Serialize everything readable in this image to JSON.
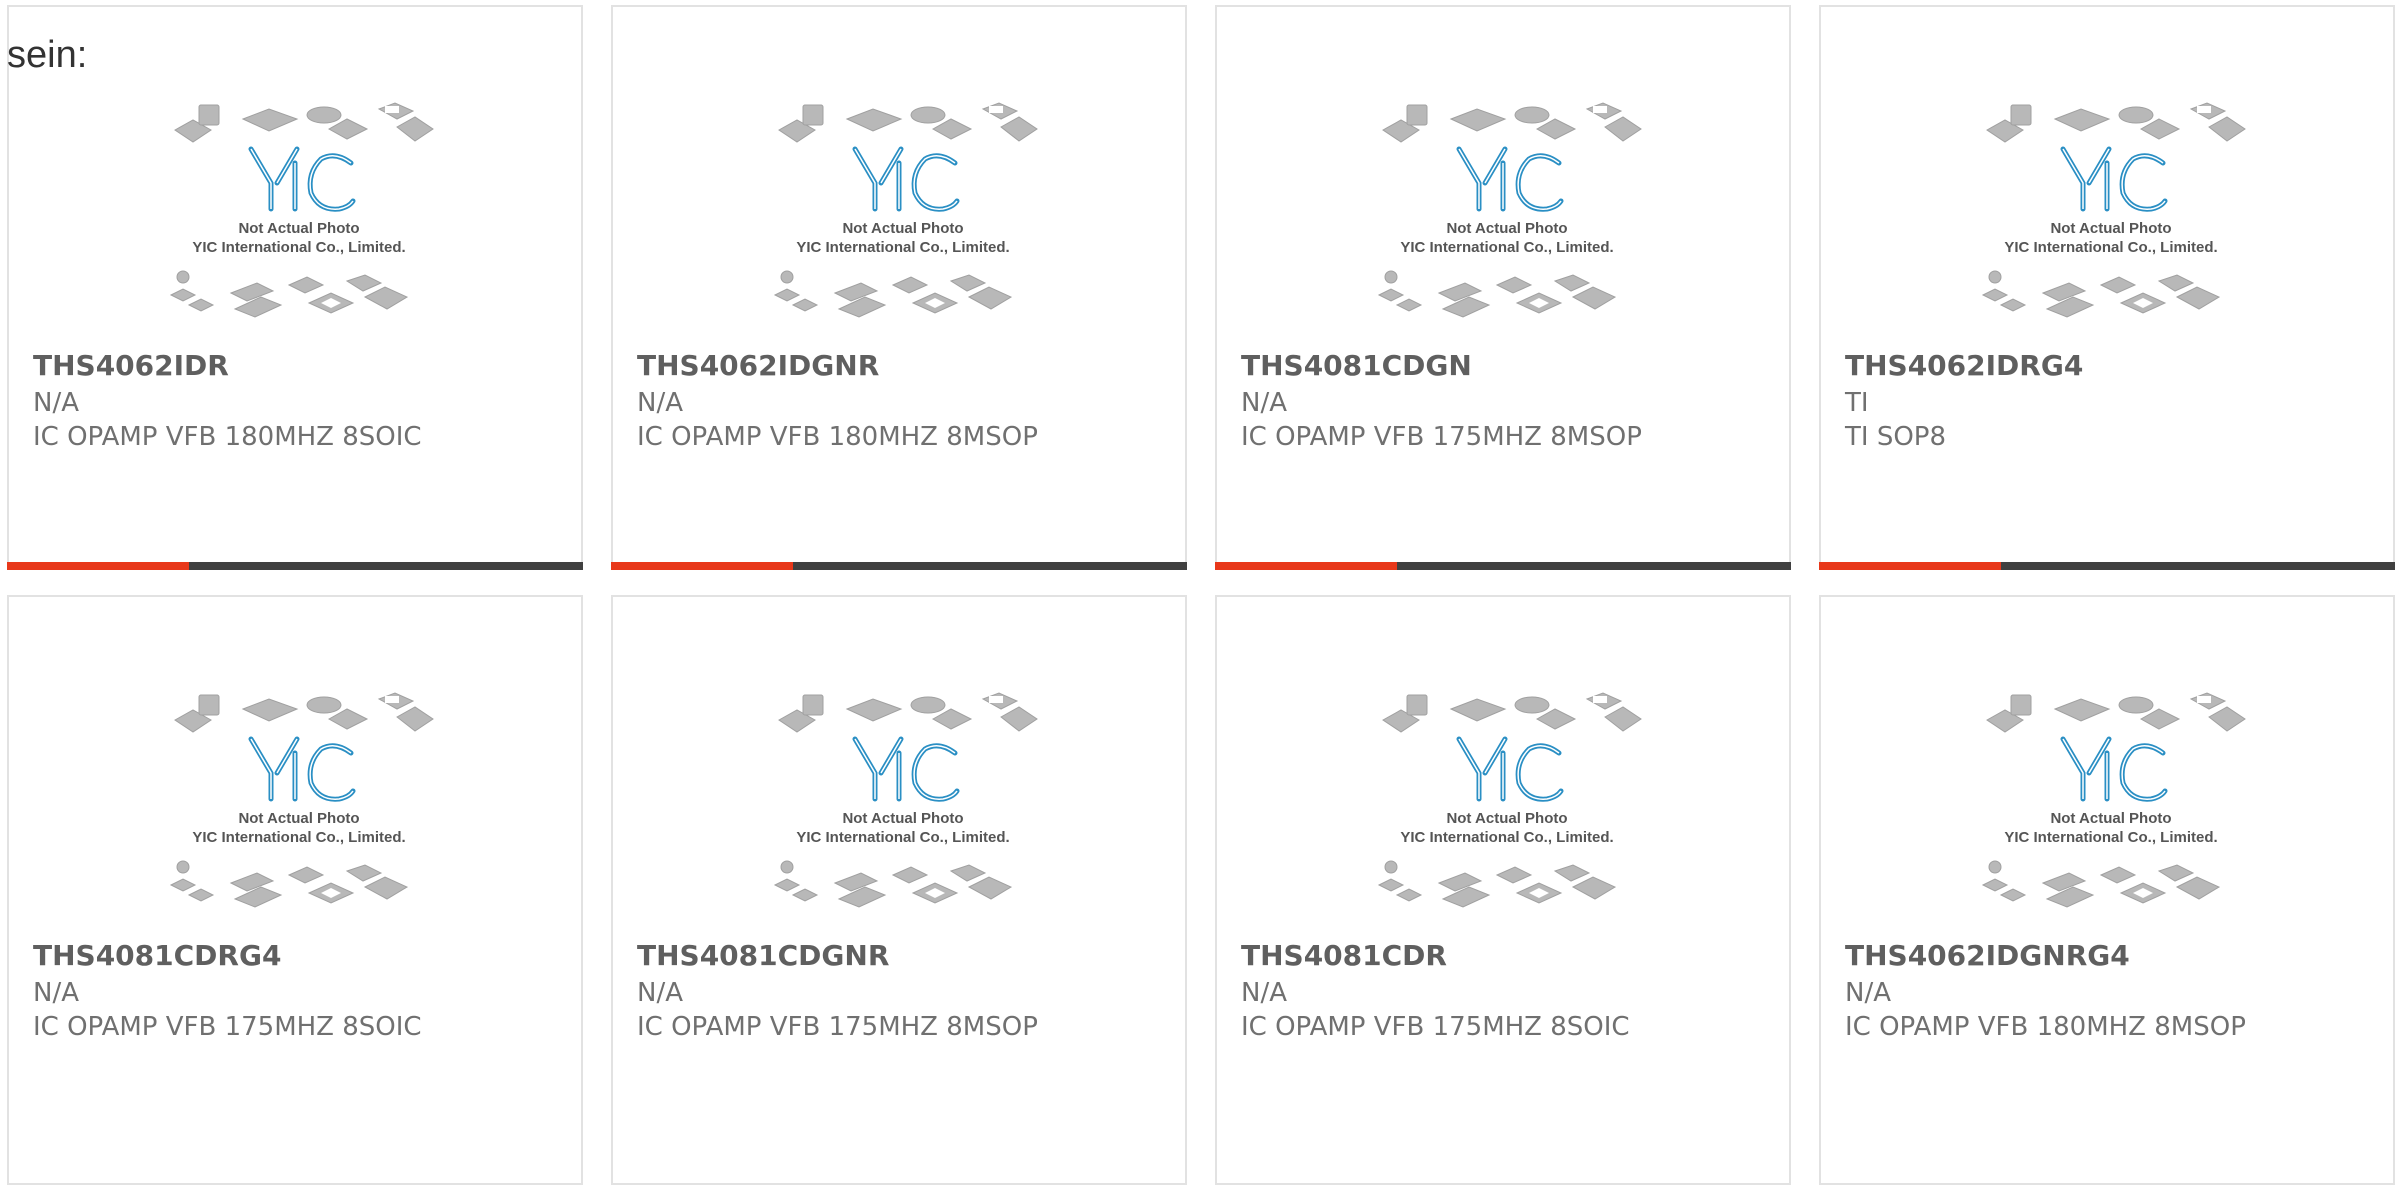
{
  "intro_text": "sein:",
  "thumbnail": {
    "logo_text": "YIC",
    "line1": "Not Actual Photo",
    "line2": "YIC International Co., Limited."
  },
  "colors": {
    "accent": "#e8381a",
    "bar": "#404040",
    "logo": "#2a8fc4"
  },
  "products": [
    {
      "part": "THS4062IDR",
      "mfr": "N/A",
      "desc": "IC OPAMP VFB 180MHZ 8SOIC"
    },
    {
      "part": "THS4062IDGNR",
      "mfr": "N/A",
      "desc": "IC OPAMP VFB 180MHZ 8MSOP"
    },
    {
      "part": "THS4081CDGN",
      "mfr": "N/A",
      "desc": "IC OPAMP VFB 175MHZ 8MSOP"
    },
    {
      "part": "THS4062IDRG4",
      "mfr": "TI",
      "desc": "TI SOP8"
    },
    {
      "part": "THS4081CDRG4",
      "mfr": "N/A",
      "desc": "IC OPAMP VFB 175MHZ 8SOIC"
    },
    {
      "part": "THS4081CDGNR",
      "mfr": "N/A",
      "desc": "IC OPAMP VFB 175MHZ 8MSOP"
    },
    {
      "part": "THS4081CDR",
      "mfr": "N/A",
      "desc": "IC OPAMP VFB 175MHZ 8SOIC"
    },
    {
      "part": "THS4062IDGNRG4",
      "mfr": "N/A",
      "desc": "IC OPAMP VFB 180MHZ 8MSOP"
    }
  ]
}
